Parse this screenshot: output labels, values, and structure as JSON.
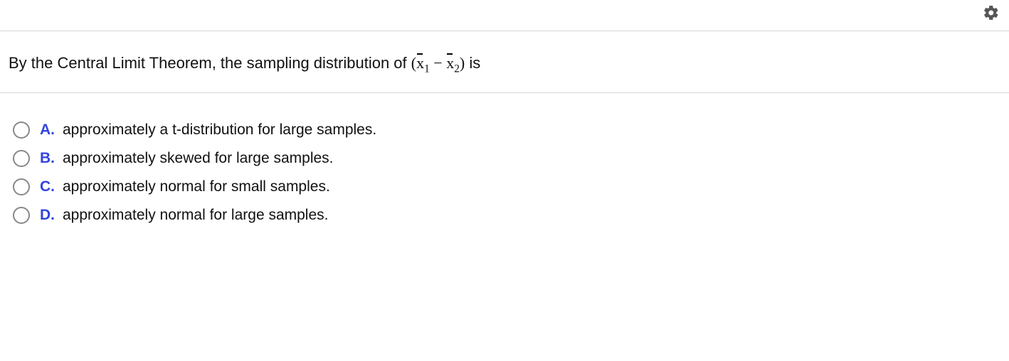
{
  "question": {
    "prefix": "By the Central Limit Theorem, the sampling distribution of ",
    "suffix": " is"
  },
  "options": [
    {
      "letter": "A.",
      "text": "approximately a t-distribution for large samples."
    },
    {
      "letter": "B.",
      "text": "approximately skewed for large samples."
    },
    {
      "letter": "C.",
      "text": "approximately normal for small samples."
    },
    {
      "letter": "D.",
      "text": "approximately normal for large samples."
    }
  ]
}
